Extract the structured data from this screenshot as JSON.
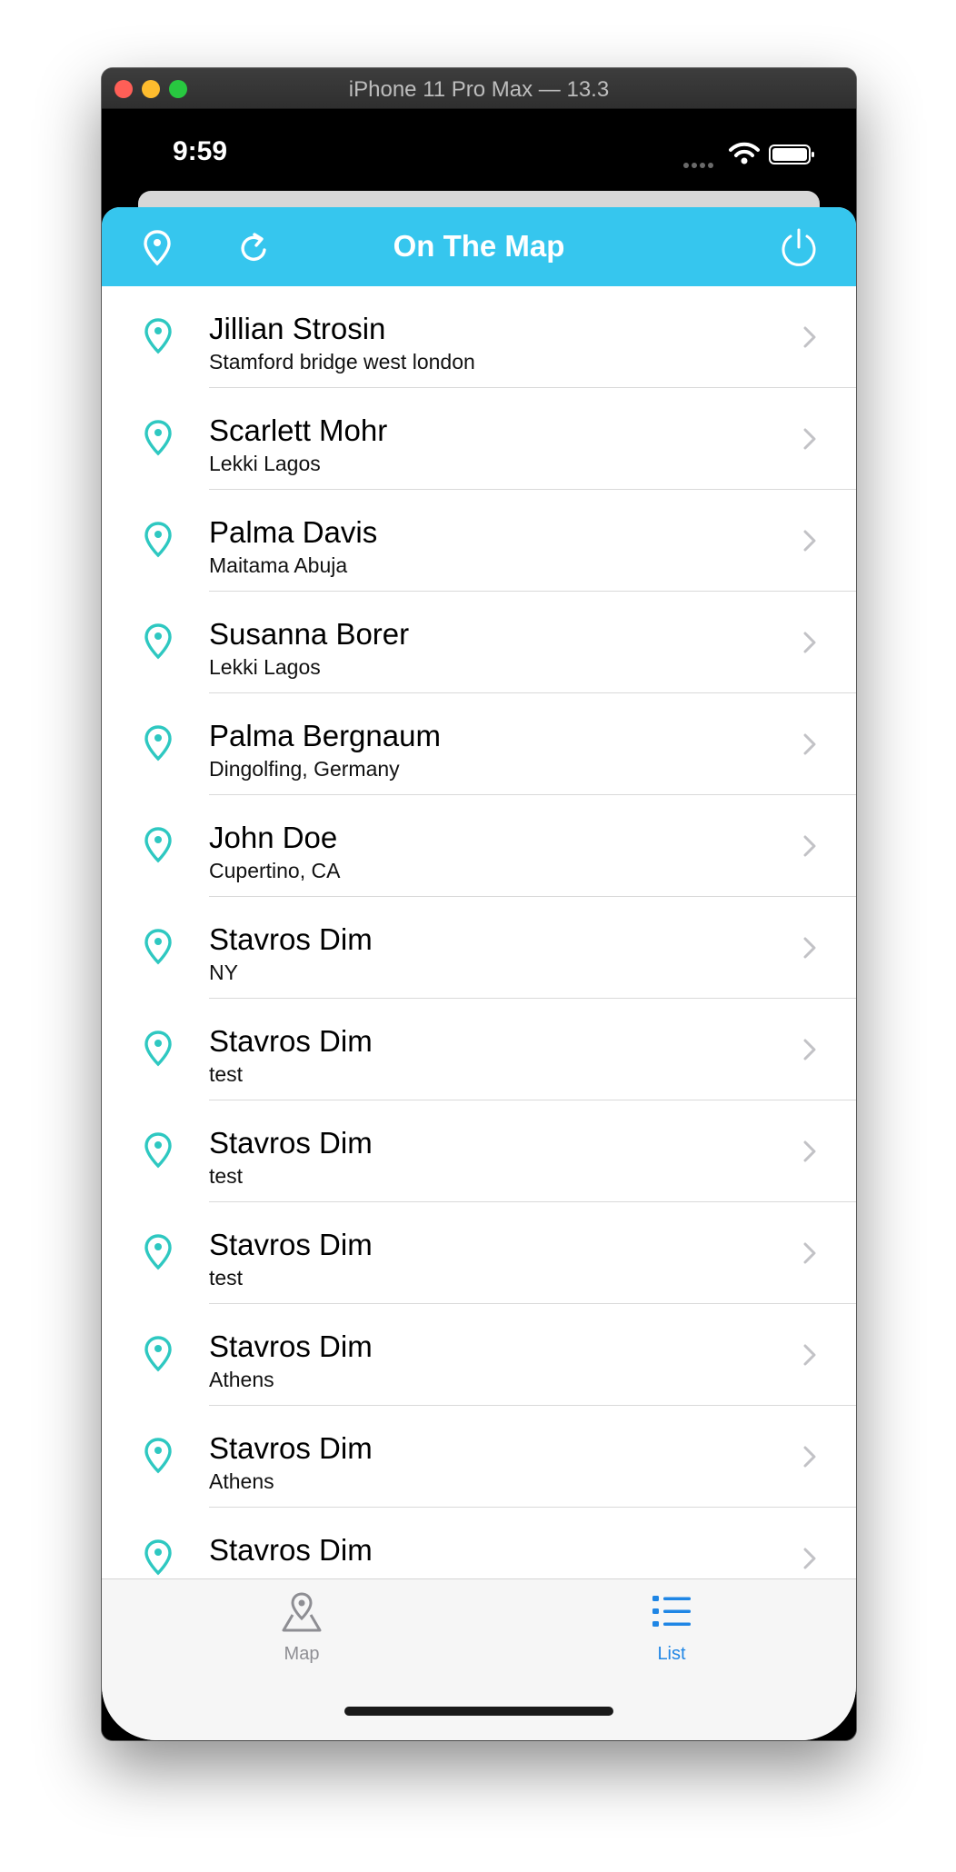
{
  "window": {
    "title": "iPhone 11 Pro Max — 13.3"
  },
  "status_bar": {
    "time": "9:59"
  },
  "nav": {
    "title": "On The Map"
  },
  "rows": [
    {
      "name": "Jillian Strosin",
      "location": "Stamford bridge west london"
    },
    {
      "name": "Scarlett Mohr",
      "location": "Lekki Lagos"
    },
    {
      "name": "Palma Davis",
      "location": "Maitama Abuja"
    },
    {
      "name": "Susanna Borer",
      "location": "Lekki Lagos"
    },
    {
      "name": "Palma Bergnaum",
      "location": "Dingolfing, Germany"
    },
    {
      "name": "John Doe",
      "location": "Cupertino, CA"
    },
    {
      "name": "Stavros Dim",
      "location": "NY"
    },
    {
      "name": "Stavros Dim",
      "location": "test"
    },
    {
      "name": "Stavros Dim",
      "location": "test"
    },
    {
      "name": "Stavros Dim",
      "location": "test"
    },
    {
      "name": "Stavros Dim",
      "location": "Athens"
    },
    {
      "name": "Stavros Dim",
      "location": "Athens"
    },
    {
      "name": "Stavros Dim",
      "location": ""
    }
  ],
  "tabs": {
    "map": {
      "label": "Map",
      "icon": "map-icon",
      "selected": false
    },
    "list": {
      "label": "List",
      "icon": "list-icon",
      "selected": true
    }
  },
  "colors": {
    "nav_bar": "#36c6ee",
    "pin": "#2ec8c1",
    "tab_selected": "#1f86e5",
    "tab_unselected": "#8e8e93"
  }
}
